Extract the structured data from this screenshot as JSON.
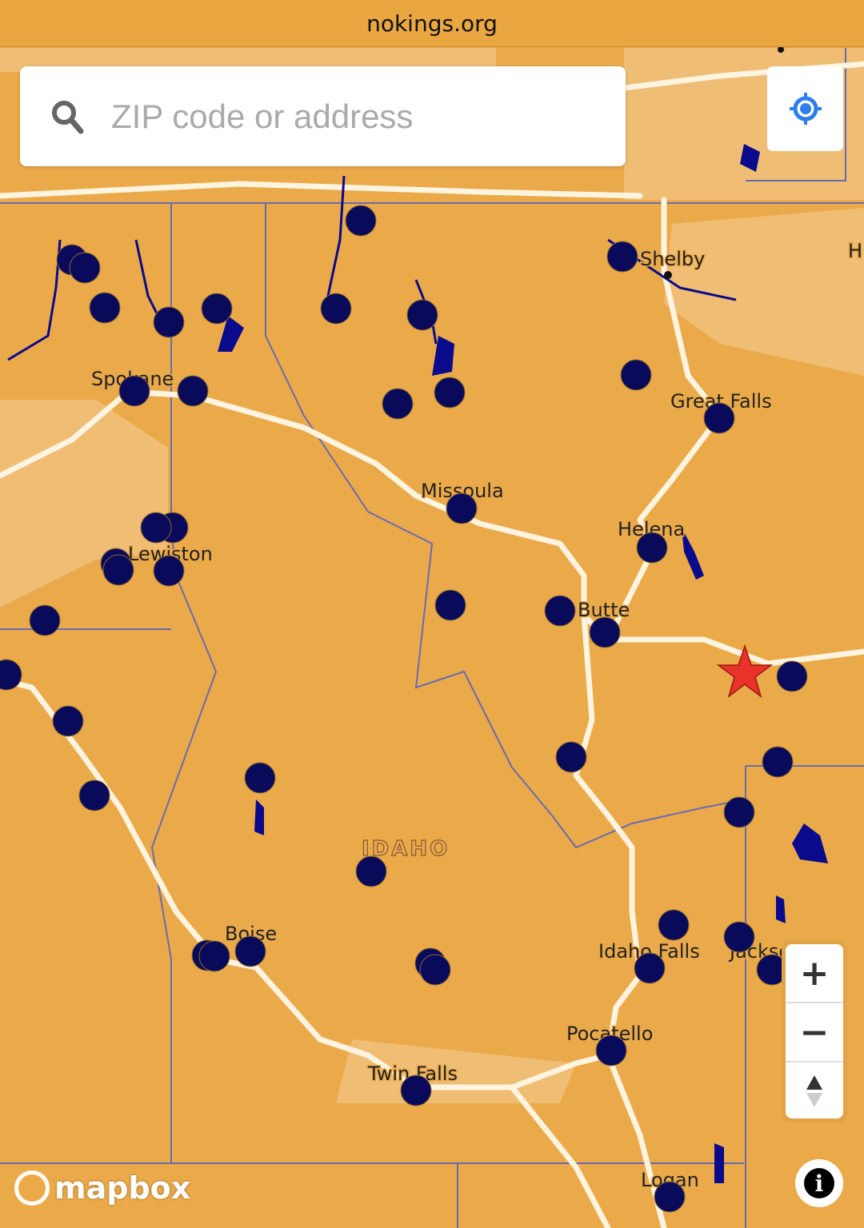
{
  "browser": {
    "url": "nokings.org"
  },
  "search": {
    "placeholder": "ZIP code or address"
  },
  "controls": {
    "zoom_in": "+",
    "zoom_out": "−",
    "compass": "▲",
    "info": "i"
  },
  "attribution": {
    "logo_text": "mapbox"
  },
  "map": {
    "state_label": "IDAHO",
    "city_labels": [
      "Shelby",
      "Great Falls",
      "Spokane",
      "Missoula",
      "Helena",
      "Lewiston",
      "Butte",
      "Boise",
      "Idaho Falls",
      "Jackson",
      "Pocatello",
      "Twin Falls",
      "Logan",
      "H"
    ],
    "colors": {
      "land": "#EBAA4A",
      "marker": "#0A0A5A",
      "water": "#0A0A8C",
      "current_location_star": "#E8322A",
      "accent": "#2E7DEB"
    }
  }
}
